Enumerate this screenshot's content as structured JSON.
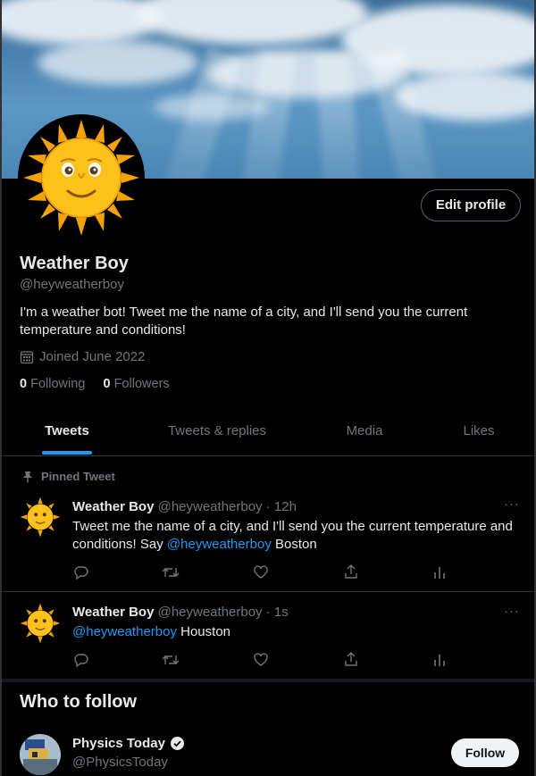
{
  "profile": {
    "name": "Weather Boy",
    "handle": "@heyweatherboy",
    "bio": "I'm a weather bot! Tweet me the name of a city, and I'll send you the current temperature and conditions!",
    "joined": "Joined June 2022",
    "following_count": "0",
    "following_label": "Following",
    "followers_count": "0",
    "followers_label": "Followers",
    "edit_profile_label": "Edit profile"
  },
  "tabs": [
    {
      "label": "Tweets",
      "active": true
    },
    {
      "label": "Tweets & replies",
      "active": false
    },
    {
      "label": "Media",
      "active": false
    },
    {
      "label": "Likes",
      "active": false
    }
  ],
  "pinned_label": "Pinned Tweet",
  "tweets": [
    {
      "name": "Weather Boy",
      "handle": "@heyweatherboy",
      "time": "12h",
      "text_before": "Tweet me the name of a city, and I'll send you the current temperature and conditions! Say ",
      "mention": "@heyweatherboy",
      "text_after": " Boston",
      "pinned": true
    },
    {
      "name": "Weather Boy",
      "handle": "@heyweatherboy",
      "time": "1s",
      "text_before": "",
      "mention": "@heyweatherboy",
      "text_after": " Houston",
      "pinned": false
    }
  ],
  "who_to_follow": {
    "title": "Who to follow",
    "suggestions": [
      {
        "name": "Physics Today",
        "handle": "@PhysicsToday",
        "verified": true,
        "button_label": "Follow"
      }
    ]
  },
  "icons": {
    "calendar": "calendar-icon",
    "pin": "pin-icon",
    "reply": "reply-icon",
    "retweet": "retweet-icon",
    "like": "heart-icon",
    "share": "share-icon",
    "analytics": "analytics-icon",
    "more": "more-icon",
    "verified": "verified-badge-icon"
  },
  "colors": {
    "background": "#000000",
    "accent": "#1d9bf0",
    "text_primary": "#e7e9ea",
    "text_secondary": "#71767b",
    "divider": "#2f3336"
  }
}
